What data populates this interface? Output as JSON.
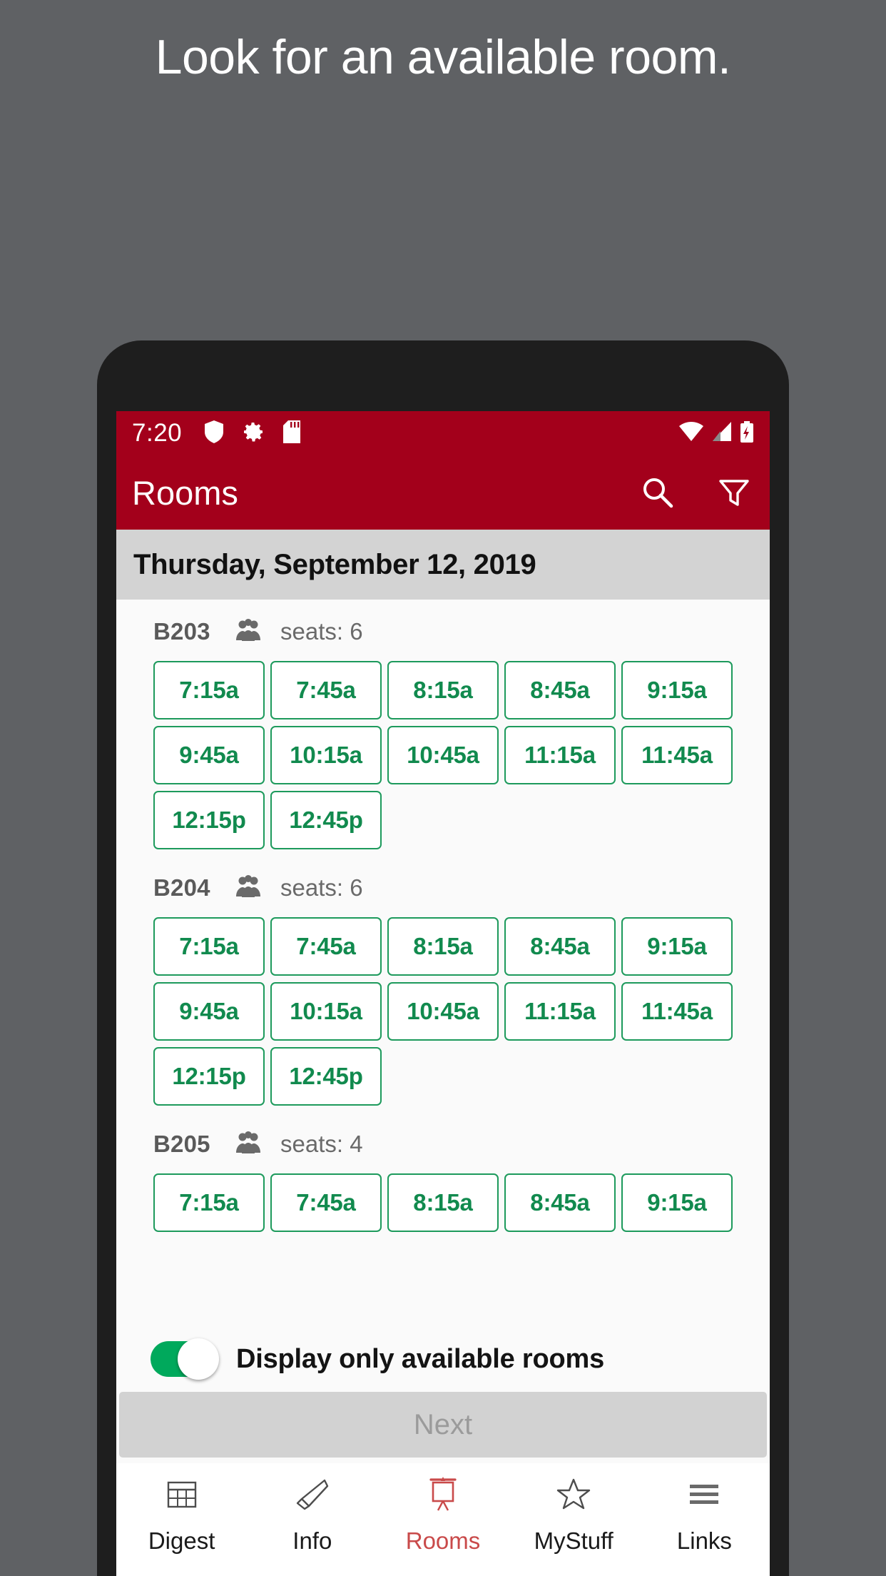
{
  "headline": "Look for an available room.",
  "colors": {
    "background": "#5f6164",
    "brand_red": "#a3001b",
    "slot_green": "#1d9a5c",
    "toggle_green": "#00a95c",
    "active_nav": "#c94a4a",
    "date_bar": "#d3d3d3",
    "next_disabled": "#d2d2d2"
  },
  "status_bar": {
    "time": "7:20",
    "left_icons": [
      "shield-icon",
      "gear-icon",
      "sd-card-icon"
    ],
    "right_icons": [
      "wifi-icon",
      "cell-signal-icon",
      "battery-charging-icon"
    ]
  },
  "app_bar": {
    "title": "Rooms",
    "actions": [
      "search-icon",
      "filter-icon"
    ]
  },
  "date_header": "Thursday, September 12, 2019",
  "rooms": [
    {
      "name": "B203",
      "seats_label": "seats: 6",
      "slot_rows": [
        [
          "7:15a",
          "7:45a",
          "8:15a",
          "8:45a",
          "9:15a"
        ],
        [
          "9:45a",
          "10:15a",
          "10:45a",
          "11:15a",
          "11:45a"
        ],
        [
          "12:15p",
          "12:45p"
        ]
      ]
    },
    {
      "name": "B204",
      "seats_label": "seats: 6",
      "slot_rows": [
        [
          "7:15a",
          "7:45a",
          "8:15a",
          "8:45a",
          "9:15a"
        ],
        [
          "9:45a",
          "10:15a",
          "10:45a",
          "11:15a",
          "11:45a"
        ],
        [
          "12:15p",
          "12:45p"
        ]
      ]
    },
    {
      "name": "B205",
      "seats_label": "seats: 4",
      "slot_rows": [
        [
          "7:15a",
          "7:45a",
          "8:15a",
          "8:45a",
          "9:15a"
        ]
      ]
    }
  ],
  "toggle": {
    "label": "Display only available rooms",
    "on": true
  },
  "next_button": {
    "label": "Next",
    "enabled": false
  },
  "bottom_nav": [
    {
      "label": "Digest",
      "icon": "calendar-icon",
      "active": false
    },
    {
      "label": "Info",
      "icon": "megaphone-icon",
      "active": false
    },
    {
      "label": "Rooms",
      "icon": "presentation-icon",
      "active": true
    },
    {
      "label": "MyStuff",
      "icon": "star-icon",
      "active": false
    },
    {
      "label": "Links",
      "icon": "hamburger-icon",
      "active": false
    }
  ]
}
